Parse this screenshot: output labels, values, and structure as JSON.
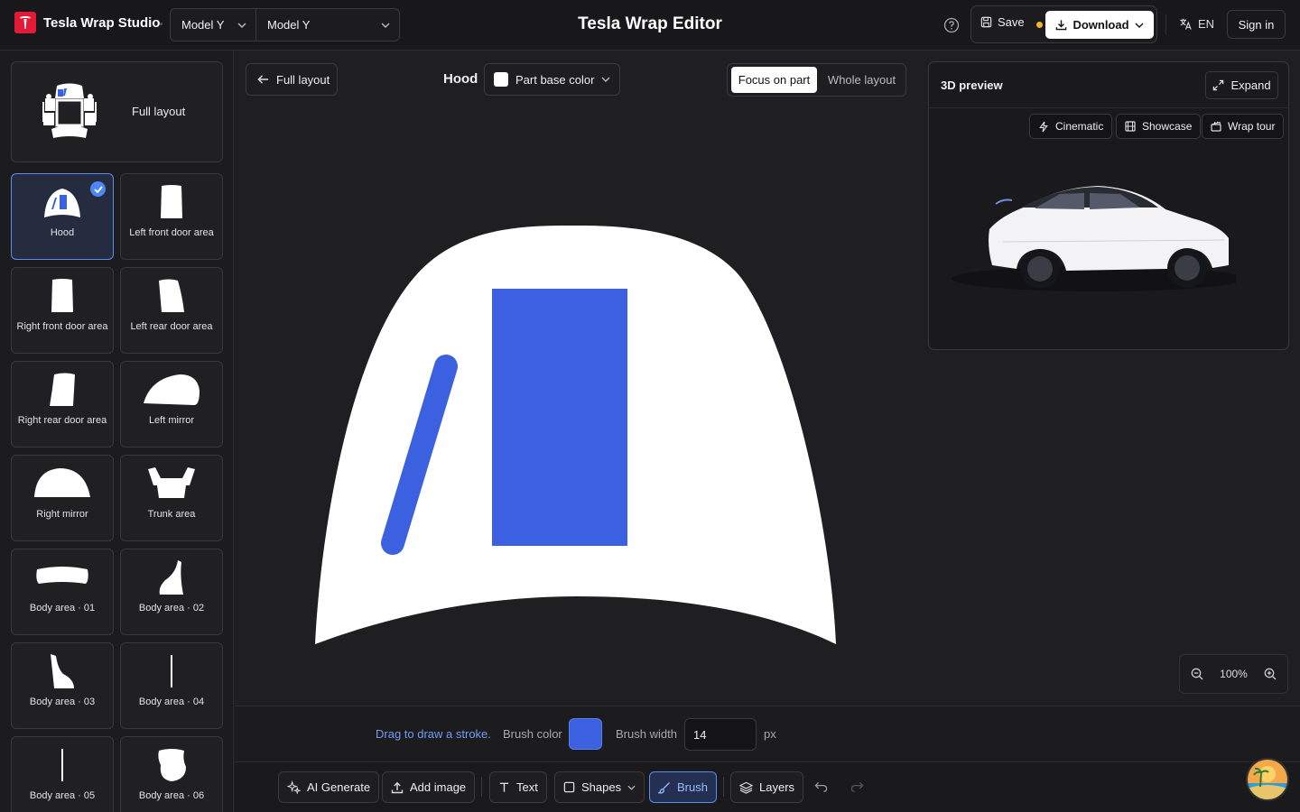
{
  "app": {
    "brand": "Tesla Wrap Studio",
    "title": "Tesla Wrap Editor"
  },
  "header": {
    "model_select": "Model Y",
    "variant_select": "Model Y",
    "save_label": "Save",
    "download_label": "Download",
    "language": "EN",
    "signin_label": "Sign in"
  },
  "sidebar": {
    "full_layout_label": "Full layout",
    "parts": [
      {
        "label": "Hood",
        "selected": true,
        "icon": "hood-icon"
      },
      {
        "label": "Left front door area",
        "icon": "left-front-door-icon"
      },
      {
        "label": "Right front door area",
        "icon": "right-front-door-icon"
      },
      {
        "label": "Left rear door area",
        "icon": "left-rear-door-icon"
      },
      {
        "label": "Right rear door area",
        "icon": "right-rear-door-icon"
      },
      {
        "label": "Left mirror",
        "icon": "left-mirror-icon"
      },
      {
        "label": "Right mirror",
        "icon": "right-mirror-icon"
      },
      {
        "label": "Trunk area",
        "icon": "trunk-icon"
      },
      {
        "label": "Body area · 01",
        "icon": "body-01-icon"
      },
      {
        "label": "Body area · 02",
        "icon": "body-02-icon"
      },
      {
        "label": "Body area · 03",
        "icon": "body-03-icon"
      },
      {
        "label": "Body area · 04",
        "icon": "body-04-icon"
      },
      {
        "label": "Body area · 05",
        "icon": "body-05-icon"
      },
      {
        "label": "Body area · 06",
        "icon": "body-06-icon"
      }
    ]
  },
  "editor": {
    "back_label": "Full layout",
    "part_name": "Hood",
    "base_color_label": "Part base color",
    "focus_on_part": "Focus on part",
    "whole_layout": "Whole layout",
    "accent_color": "#3b61e0",
    "base_color": "#ffffff"
  },
  "preview": {
    "title": "3D preview",
    "expand_label": "Expand",
    "modes": [
      "Cinematic",
      "Showcase",
      "Wrap tour"
    ]
  },
  "zoom": {
    "level": "100%"
  },
  "brush": {
    "hint": "Drag to draw a stroke.",
    "color_label": "Brush color",
    "width_label": "Brush width",
    "width_value": "14",
    "unit": "px",
    "color": "#3b61e0"
  },
  "toolbar": {
    "ai_generate": "AI Generate",
    "add_image": "Add image",
    "text": "Text",
    "shapes": "Shapes",
    "brush": "Brush",
    "layers": "Layers"
  }
}
